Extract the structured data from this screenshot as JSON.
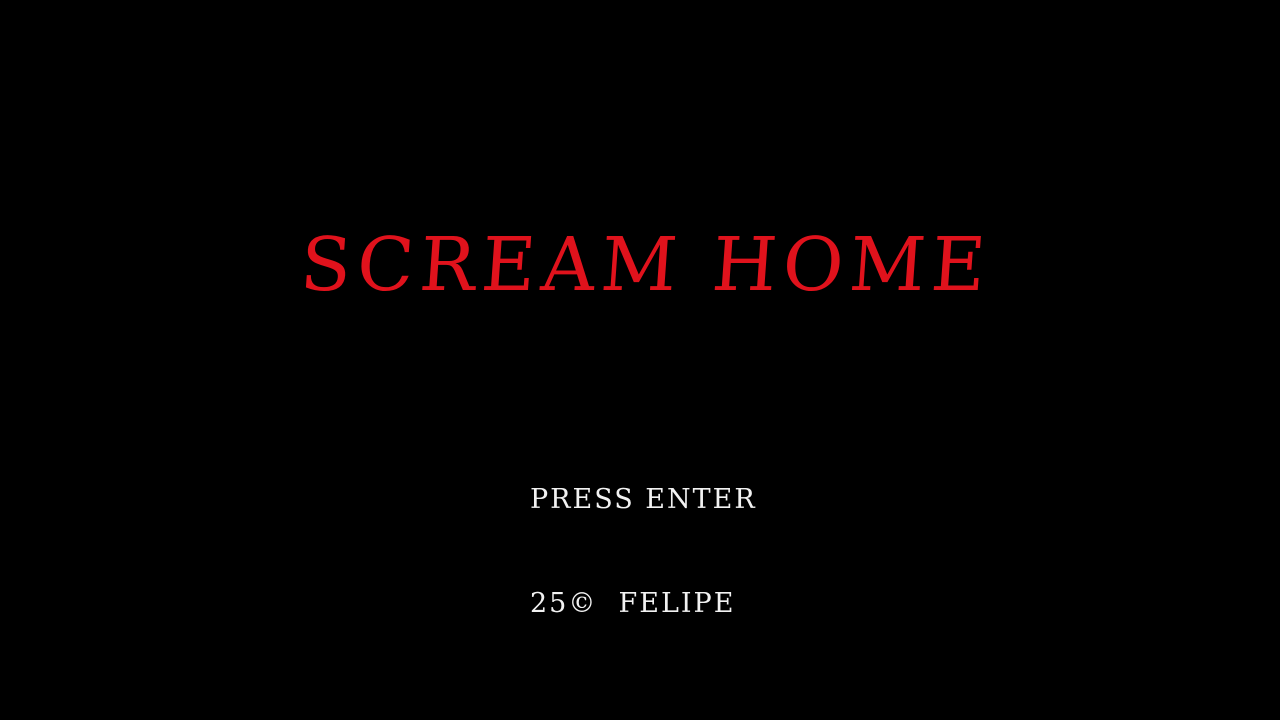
{
  "game": {
    "title": "SCREAM HOME",
    "prompt": "PRESS ENTER",
    "credit": "25©  FELIPE"
  },
  "colors": {
    "background": "#000000",
    "title": "#e0121c",
    "text": "#f2f2f2"
  }
}
